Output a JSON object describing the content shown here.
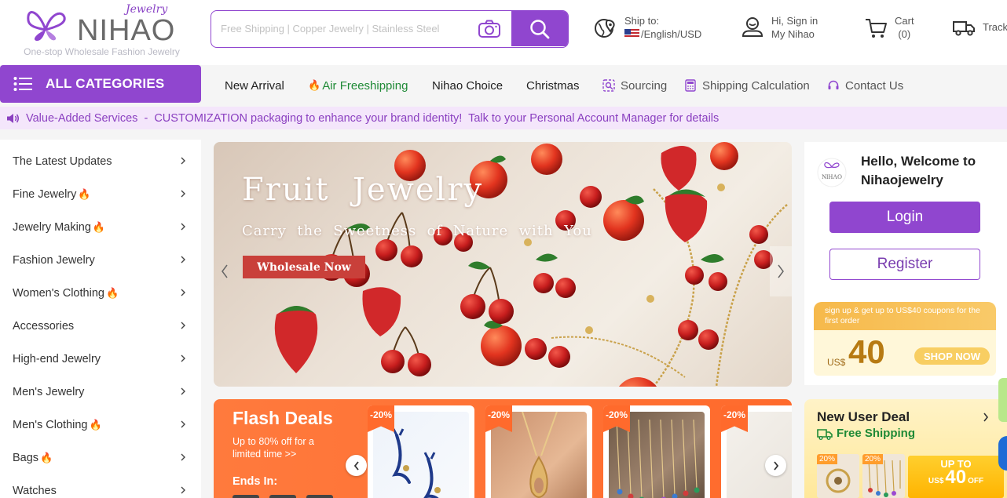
{
  "brand": {
    "script": "Jewelry",
    "name": "NIHAO",
    "tagline": "One-stop Wholesale Fashion Jewelry"
  },
  "search": {
    "placeholder": "Free Shipping | Copper Jewelry | Stainless Steel"
  },
  "header": {
    "ship_label": "Ship to:",
    "ship_value": "/English/USD",
    "sign_line1": "Hi, Sign in",
    "sign_line2": "My Nihao",
    "cart_label": "Cart",
    "cart_count": "(0)",
    "track_label": "Track"
  },
  "nav": {
    "all_categories": "ALL CATEGORIES",
    "links": [
      "New Arrival",
      "Air Freeshipping",
      "Nihao Choice",
      "Christmas",
      "Sourcing",
      "Shipping Calculation",
      "Contact Us"
    ]
  },
  "announcement": "Value-Added Services  -  CUSTOMIZATION packaging to enhance your brand identity!  Talk to your Personal Account Manager for details",
  "categories": [
    {
      "label": "The Latest Updates",
      "hot": ""
    },
    {
      "label": "Fine Jewelry",
      "hot": "🔥"
    },
    {
      "label": "Jewelry Making",
      "hot": "🔥"
    },
    {
      "label": "Fashion Jewelry",
      "hot": ""
    },
    {
      "label": "Women's Clothing",
      "hot": "🔥"
    },
    {
      "label": "Accessories",
      "hot": ""
    },
    {
      "label": "High-end Jewelry",
      "hot": ""
    },
    {
      "label": "Men's Jewelry",
      "hot": ""
    },
    {
      "label": "Men's Clothing",
      "hot": "🔥"
    },
    {
      "label": "Bags",
      "hot": "🔥"
    },
    {
      "label": "Watches",
      "hot": ""
    }
  ],
  "banner": {
    "title": "Fruit  Jewelry",
    "subtitle": "Carry  the  Sweetness  of  Nature  with  You",
    "button": "Wholesale Now"
  },
  "welcome": {
    "avatar_text": "NIHAO",
    "greeting": "Hello, Welcome to Nihaojewelry",
    "login": "Login",
    "register": "Register",
    "coupon_text": "sign up & get up to US$40 coupons for the first order",
    "coupon_currency": "US$",
    "coupon_amount": "40",
    "coupon_button": "SHOP NOW"
  },
  "flash": {
    "title": "Flash Deals",
    "subtitle": "Up to 80% off for a limited time >>",
    "ends_in": "Ends In:",
    "badges": [
      "-20%",
      "-20%",
      "-20%",
      "-20%"
    ]
  },
  "new_user": {
    "title": "New User Deal",
    "free_shipping": "Free Shipping",
    "thumb_badges": [
      "20%",
      "20%"
    ],
    "coupon_upto": "UP TO",
    "coupon_currency": "US$",
    "coupon_amount": "40",
    "coupon_off": "OFF"
  },
  "colors": {
    "brand_purple": "#9046cf",
    "announce_bg": "#f4e6fb",
    "flash_orange": "#ff6a2c",
    "free_green": "#1f8a36",
    "hot_red": "#e53d1c"
  },
  "icons": {
    "camera": "camera-icon",
    "search": "search-icon",
    "location": "globe-pin-icon",
    "user": "user-icon",
    "cart": "cart-icon",
    "truck": "truck-icon",
    "menu": "menu-icon",
    "speaker": "speaker-icon",
    "chevron": "chevron-right-icon"
  }
}
